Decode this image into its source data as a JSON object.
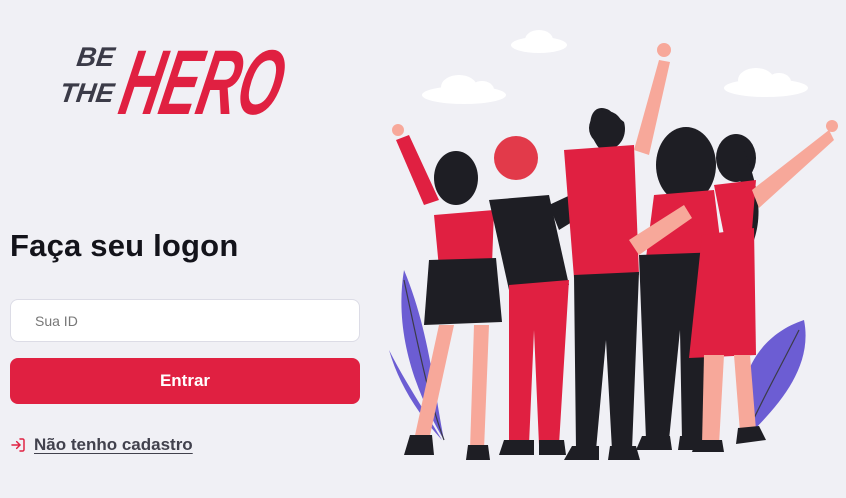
{
  "brand": {
    "line1": "BE",
    "line2": "THE",
    "name": "HERO",
    "primary_color": "#e02041",
    "dark_color": "#3b3b48"
  },
  "login": {
    "title": "Faça seu logon",
    "id_placeholder": "Sua ID",
    "id_value": "",
    "submit_label": "Entrar",
    "register_link_label": "Não tenho cadastro",
    "register_icon": "log-in-icon"
  },
  "illustration": {
    "subject": "heroes-group-illustration"
  }
}
